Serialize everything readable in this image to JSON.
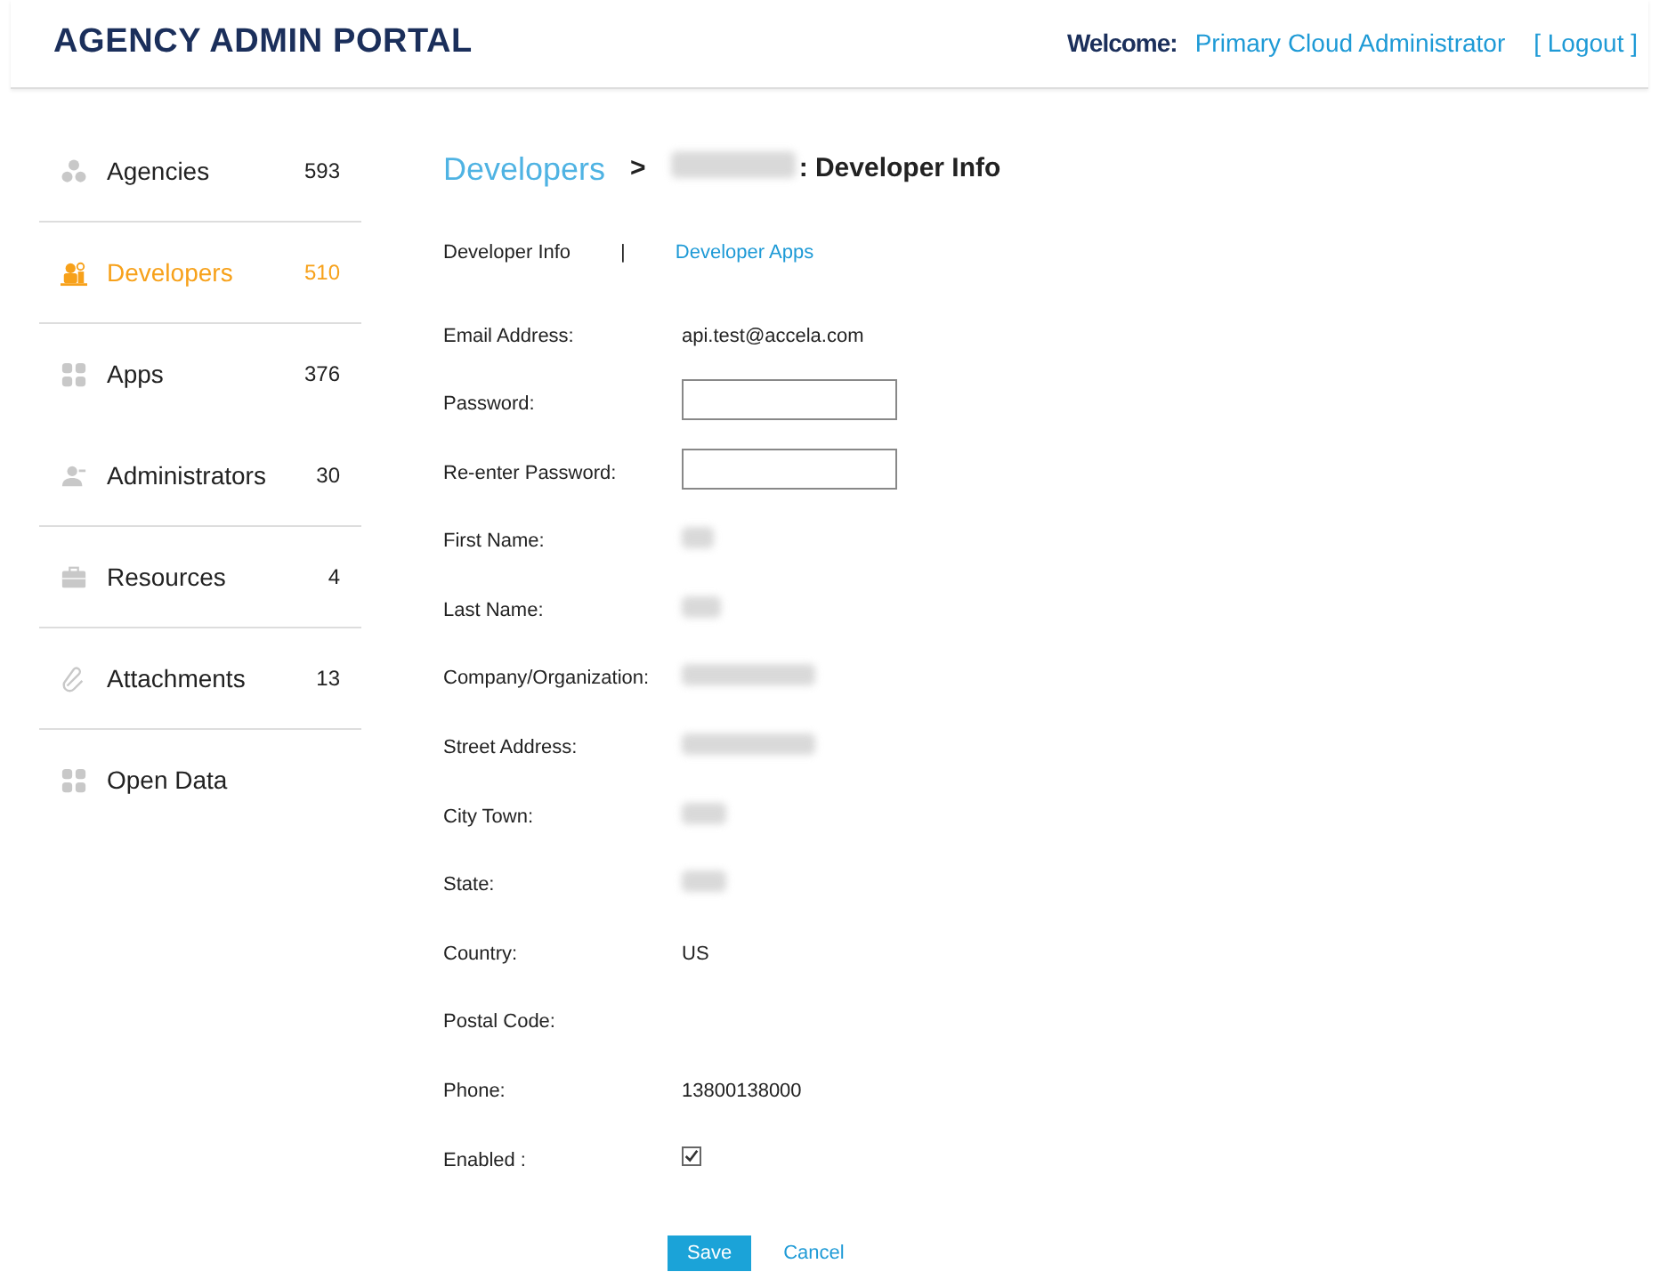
{
  "header": {
    "title": "AGENCY ADMIN PORTAL",
    "welcome_label": "Welcome:",
    "user": "Primary Cloud Administrator",
    "logout": "[ Logout ]"
  },
  "sidebar": {
    "items": [
      {
        "label": "Agencies",
        "count": "593",
        "selected": false,
        "separator": true
      },
      {
        "label": "Developers",
        "count": "510",
        "selected": true,
        "separator": true
      },
      {
        "label": "Apps",
        "count": "376",
        "selected": false,
        "separator": false
      },
      {
        "label": "Administrators",
        "count": "30",
        "selected": false,
        "separator": true
      },
      {
        "label": "Resources",
        "count": "4",
        "selected": false,
        "separator": true
      },
      {
        "label": "Attachments",
        "count": "13",
        "selected": false,
        "separator": true
      },
      {
        "label": "Open Data",
        "selected": false,
        "separator": false
      }
    ]
  },
  "breadcrumb": {
    "link": "Developers",
    "separator": ">",
    "current_redacted": true,
    "current": ": Developer Info"
  },
  "tabs": [
    {
      "label": "Developer Info",
      "selected": true
    },
    {
      "label": "Developer Apps",
      "selected": false
    }
  ],
  "tab_separator": "|",
  "fields": [
    {
      "label": "Email Address:",
      "kind": "text",
      "value": "api.test@accela.com"
    },
    {
      "label": "Password:",
      "kind": "password"
    },
    {
      "label": "Re-enter Password:",
      "kind": "password"
    },
    {
      "label": "First Name:",
      "kind": "redacted"
    },
    {
      "label": "Last Name:",
      "kind": "redacted"
    },
    {
      "label": "Company/Organization:",
      "kind": "redacted"
    },
    {
      "label": "Street Address:",
      "kind": "redacted"
    },
    {
      "label": "City Town:",
      "kind": "redacted"
    },
    {
      "label": "State:",
      "kind": "redacted"
    },
    {
      "label": "Country:",
      "kind": "text",
      "value": "US"
    },
    {
      "label": "Postal Code:",
      "kind": "text"
    },
    {
      "label": "Phone:",
      "kind": "text",
      "value": "13800138000"
    },
    {
      "label": "Enabled :",
      "kind": "checkbox",
      "checked": true
    }
  ],
  "buttons": {
    "save": "Save",
    "cancel": "Cancel"
  }
}
